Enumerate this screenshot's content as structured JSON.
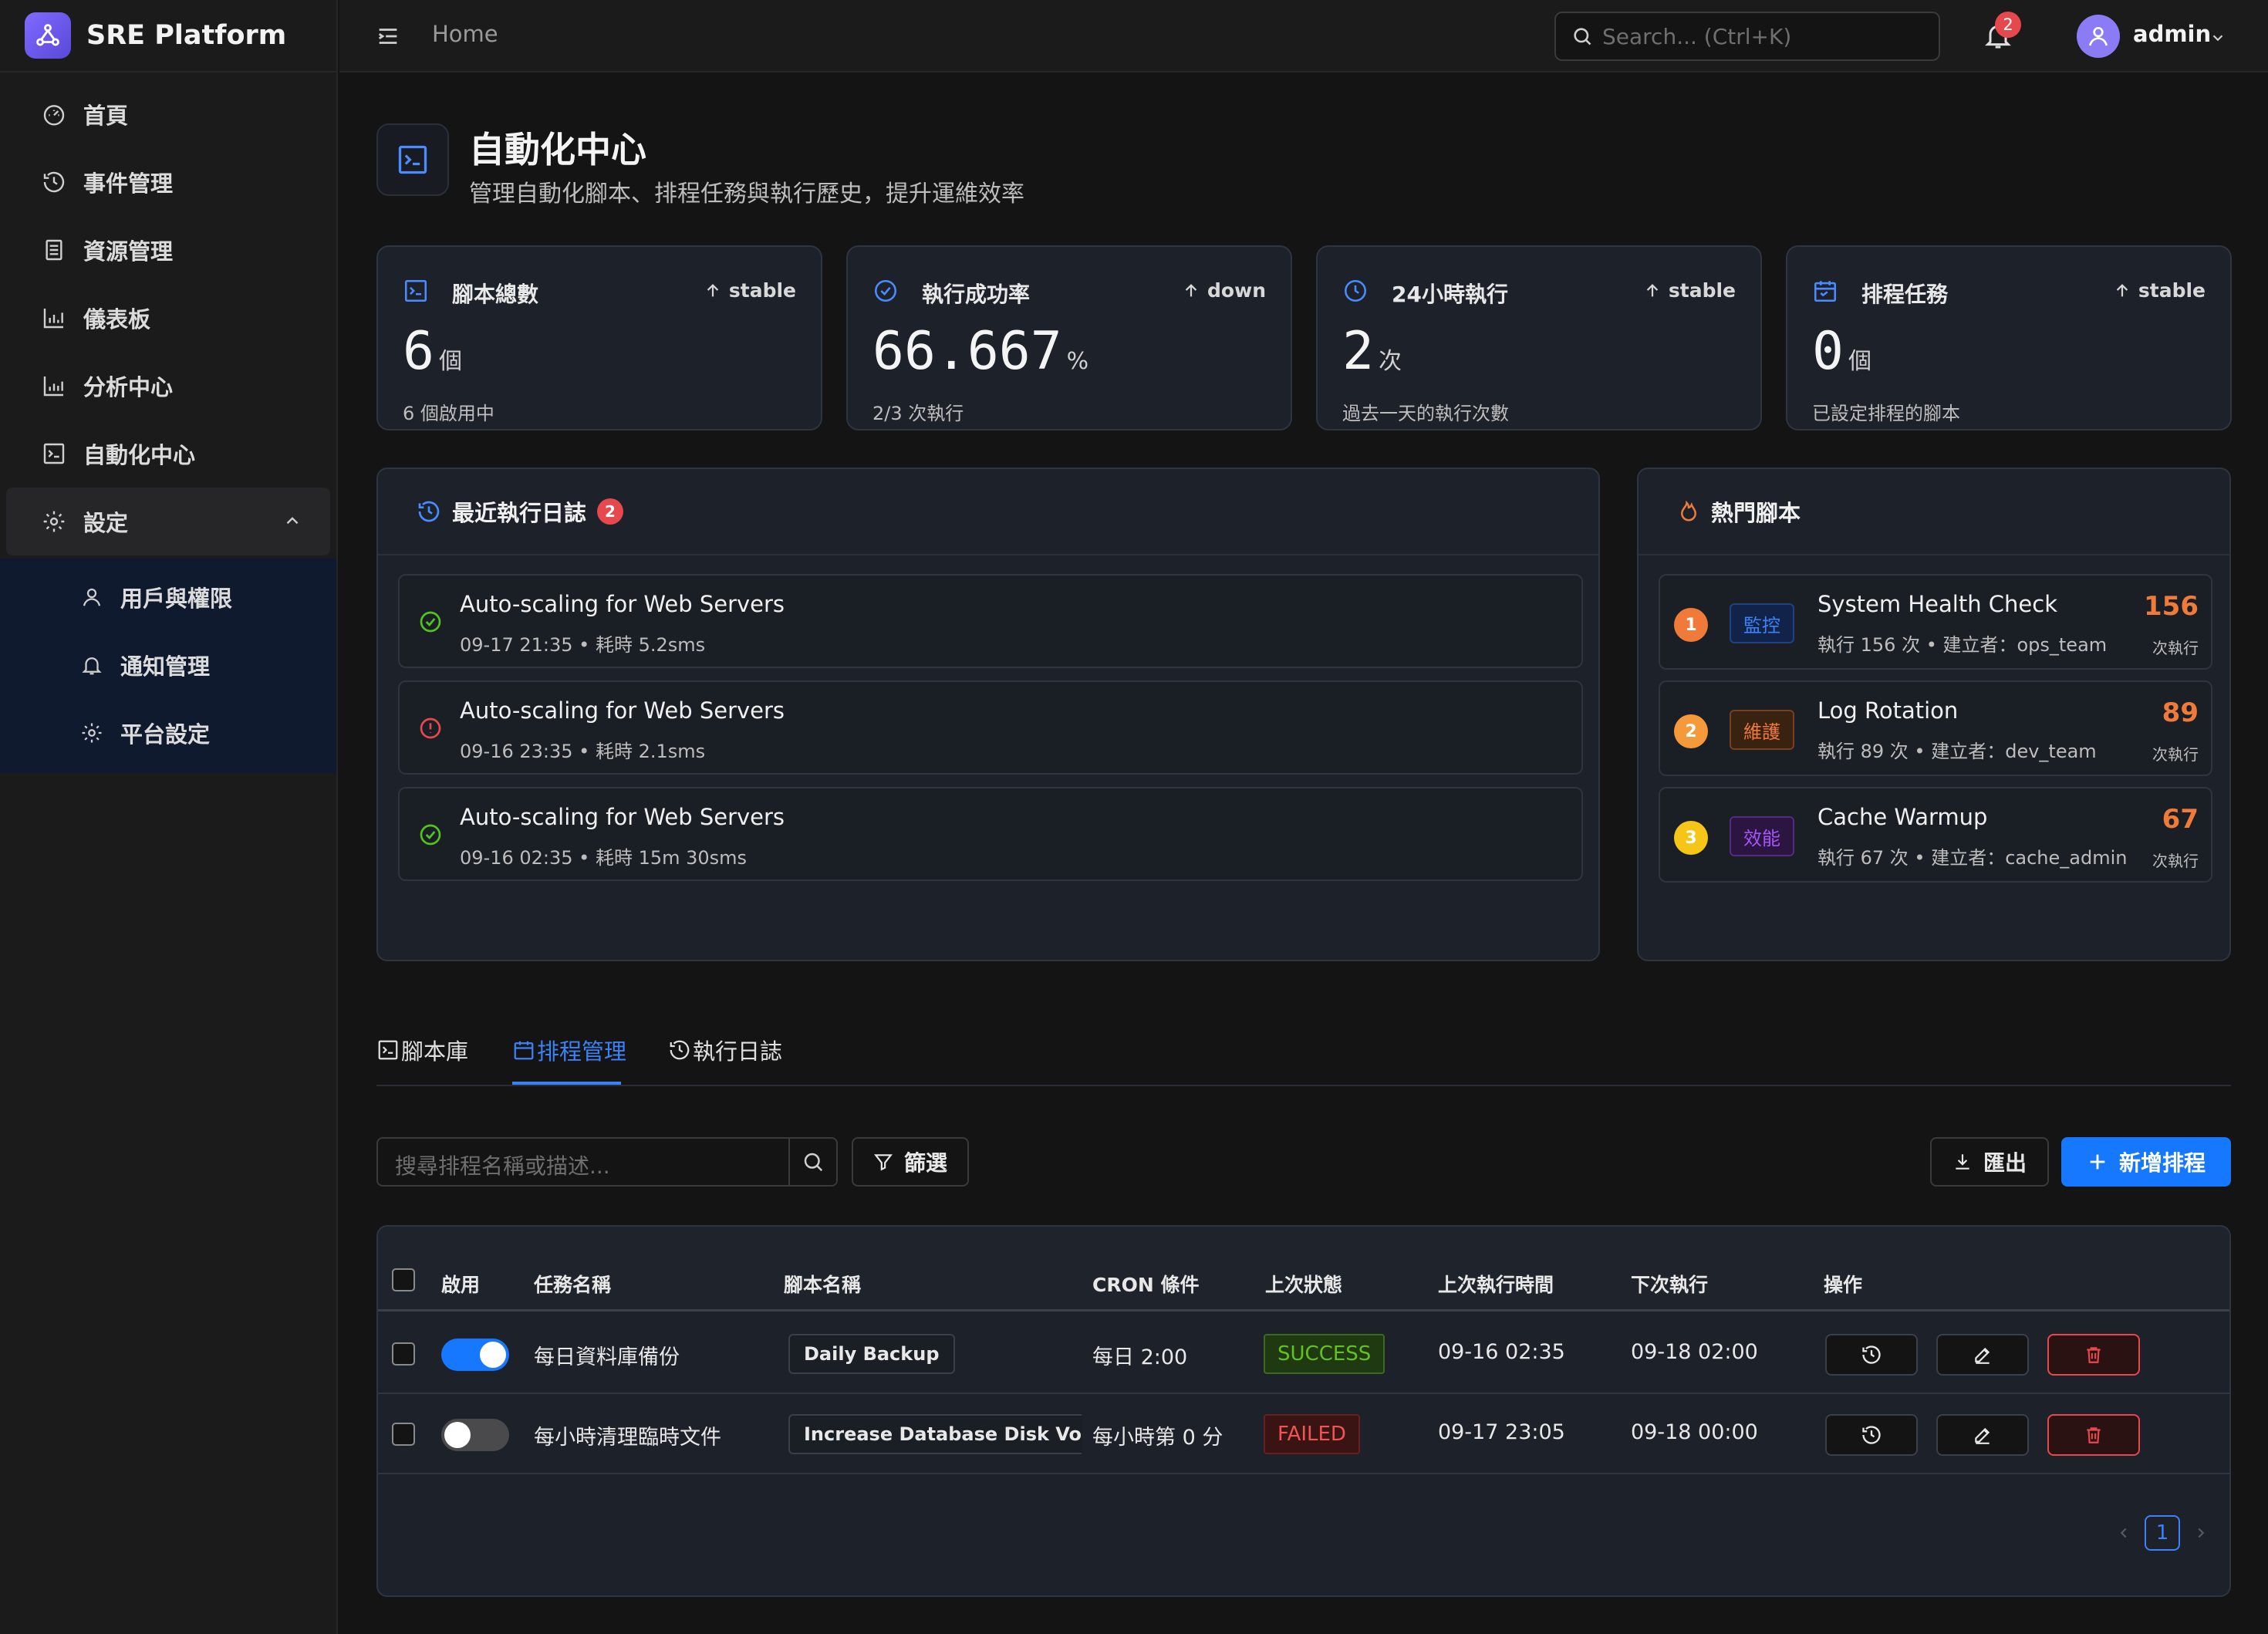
{
  "app": {
    "name": "SRE Platform"
  },
  "sidebar": {
    "items": [
      {
        "label": "首頁",
        "icon": "dashboard-gauge-icon"
      },
      {
        "label": "事件管理",
        "icon": "clock-icon"
      },
      {
        "label": "資源管理",
        "icon": "database-icon"
      },
      {
        "label": "儀表板",
        "icon": "bar-chart-icon"
      },
      {
        "label": "分析中心",
        "icon": "bar-chart-icon"
      },
      {
        "label": "自動化中心",
        "icon": "terminal-icon"
      },
      {
        "label": "設定",
        "icon": "gear-icon",
        "expanded": true
      }
    ],
    "sub_items": [
      {
        "label": "用戶與權限",
        "icon": "user-icon"
      },
      {
        "label": "通知管理",
        "icon": "bell-icon"
      },
      {
        "label": "平台設定",
        "icon": "gear-icon"
      }
    ]
  },
  "topbar": {
    "breadcrumb": "Home",
    "search_placeholder": "Search... (Ctrl+K)",
    "notification_count": "2",
    "user": "admin"
  },
  "page": {
    "title": "自動化中心",
    "subtitle": "管理自動化腳本、排程任務與執行歷史，提升運維效率"
  },
  "stats": [
    {
      "label": "腳本總數",
      "trend": "stable",
      "value": "6",
      "unit": "個",
      "note": "6 個啟用中",
      "icon": "terminal-icon"
    },
    {
      "label": "執行成功率",
      "trend": "down",
      "value": "66.667",
      "unit": "%",
      "note": "2/3 次執行",
      "icon": "check-circle-icon"
    },
    {
      "label": "24小時執行",
      "trend": "stable",
      "value": "2",
      "unit": "次",
      "note": "過去一天的執行次數",
      "icon": "clock-icon"
    },
    {
      "label": "排程任務",
      "trend": "stable",
      "value": "0",
      "unit": "個",
      "note": "已設定排程的腳本",
      "icon": "calendar-icon"
    }
  ],
  "recent_logs": {
    "title": "最近執行日誌",
    "badge": "2",
    "items": [
      {
        "title": "Auto-scaling for Web Servers",
        "meta": "09-17 21:35 • 耗時 5.2sms",
        "status": "success"
      },
      {
        "title": "Auto-scaling for Web Servers",
        "meta": "09-16 23:35 • 耗時 2.1sms",
        "status": "error"
      },
      {
        "title": "Auto-scaling for Web Servers",
        "meta": "09-16 02:35 • 耗時 15m 30sms",
        "status": "success"
      }
    ]
  },
  "hot_scripts": {
    "title": "熱門腳本",
    "unit": "次執行",
    "items": [
      {
        "rank": "1",
        "tag": "監控",
        "title": "System Health Check",
        "meta": "執行 156 次 • 建立者：ops_team",
        "count": "156",
        "rank_color": "#f07a3a",
        "tag_color": "#3b82f6",
        "tag_bg": "#12234a"
      },
      {
        "rank": "2",
        "tag": "維護",
        "title": "Log Rotation",
        "meta": "執行 89 次 • 建立者：dev_team",
        "count": "89",
        "rank_color": "#f59a3a",
        "tag_color": "#f07a3a",
        "tag_bg": "#3a2210"
      },
      {
        "rank": "3",
        "tag": "效能",
        "title": "Cache Warmup",
        "meta": "執行 67 次 • 建立者：cache_admin",
        "count": "67",
        "rank_color": "#f5c518",
        "tag_color": "#a855f7",
        "tag_bg": "#2a1640"
      }
    ]
  },
  "tabs": [
    {
      "label": "腳本庫",
      "active": false
    },
    {
      "label": "排程管理",
      "active": true
    },
    {
      "label": "執行日誌",
      "active": false
    }
  ],
  "toolbar": {
    "search_placeholder": "搜尋排程名稱或描述...",
    "filter_label": "篩選",
    "export_label": "匯出",
    "add_label": "新增排程"
  },
  "table": {
    "headers": [
      "啟用",
      "任務名稱",
      "腳本名稱",
      "CRON 條件",
      "上次狀態",
      "上次執行時間",
      "下次執行",
      "操作"
    ],
    "rows": [
      {
        "enabled": true,
        "task": "每日資料庫備份",
        "script": "Daily Backup",
        "cron": "每日 2:00",
        "status": "SUCCESS",
        "last_run": "09-16 02:35",
        "next_run": "09-18 02:00"
      },
      {
        "enabled": false,
        "task": "每小時清理臨時文件",
        "script": "Increase Database Disk Volume",
        "cron": "每小時第 0 分",
        "status": "FAILED",
        "last_run": "09-17 23:05",
        "next_run": "09-18 00:00"
      }
    ]
  },
  "pagination": {
    "current": "1"
  },
  "colors": {
    "accent": "#1677ff",
    "success": "#62c21e",
    "danger": "#e5484d",
    "hot_count": "#f07a3a"
  }
}
